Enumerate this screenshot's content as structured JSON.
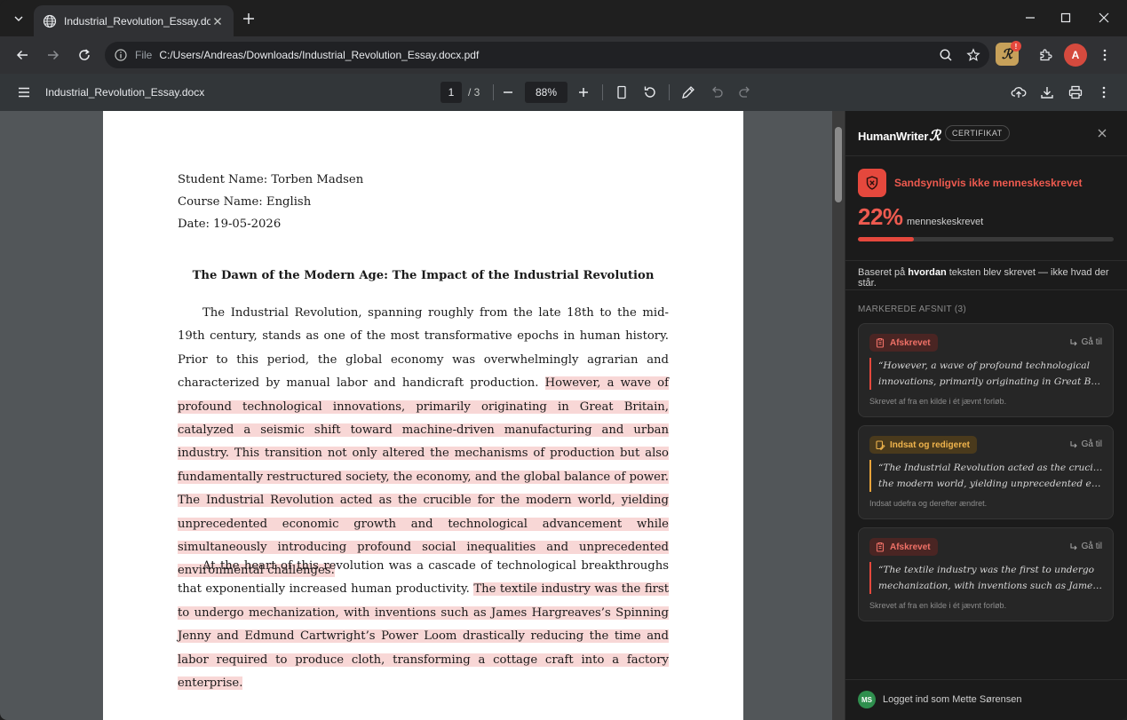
{
  "browser": {
    "tab_title": "Industrial_Revolution_Essay.docx...",
    "scheme_label": "File",
    "url": "C:/Users/Andreas/Downloads/Industrial_Revolution_Essay.docx.pdf",
    "extension_badge": "!",
    "profile_initial": "A"
  },
  "pdf_toolbar": {
    "doc_title": "Industrial_Revolution_Essay.docx",
    "page_current": "1",
    "page_total": "/ 3",
    "zoom": "88%"
  },
  "document": {
    "student": "Student Name: Torben Madsen",
    "course": "Course Name: English",
    "date": "Date: 19-05-2026",
    "title": "The Dawn of the Modern Age: The Impact of the Industrial Revolution",
    "p1_plain": "The Industrial Revolution, spanning roughly from the late 18th to the mid-19th century, stands as one of the most transformative epochs in human history. Prior to this period, the global economy was overwhelmingly agrarian and characterized by manual labor and handicraft production. ",
    "p1_hl1": "However, a wave of profound technological innovations, primarily originating in Great Britain, catalyzed a seismic shift toward machine-driven manufacturing and urban industry. This transition not only altered the mechanisms of production but also fundamentally restructured society, the economy, and the global balance of power.",
    "p1_hl2": "The Industrial Revolution acted as the crucible for the modern world, yielding unprecedented economic growth and technological advancement while simultaneously introducing profound social inequalities and unprecedented environmental challenges.",
    "p2_plain": "At the heart of this revolution was a cascade of technological breakthroughs that exponentially increased human productivity. ",
    "p2_hl": "The textile industry was the first to undergo mechanization, with inventions such as James Hargreaves’s Spinning Jenny and Edmund Cartwright’s Power Loom drastically reducing the time and labor required to produce cloth, transforming a cottage craft into a factory enterprise."
  },
  "sidebar": {
    "brand": "HumanWriter",
    "brand_mark": "ℛ",
    "cert_label": "CERTIFIKAT",
    "verdict": "Sandsynligvis ikke menneskeskrevet",
    "percent_text": "22%",
    "percent_value": 22,
    "percent_label": "menneskeskrevet",
    "basis_pre": "Baseret på ",
    "basis_bold": "hvordan",
    "basis_post": " teksten blev skrevet — ikke hvad der står.",
    "section_header": "MARKEREDE AFSNIT (3)",
    "goto_label": "Gå til",
    "cards": [
      {
        "tag": "Afskrevet",
        "line1": "“However, a wave of profound technological",
        "line2": "innovations, primarily originating in Great Britain,...",
        "note": "Skrevet af fra en kilde i ét jævnt forløb."
      },
      {
        "tag": "Indsat og redigeret",
        "line1": "“The Industrial Revolution acted as the crucible for",
        "line2": "the modern world, yielding unprecedented economi...",
        "note": "Indsat udefra og derefter ændret."
      },
      {
        "tag": "Afskrevet",
        "line1": "“The textile industry was the first to undergo",
        "line2": "mechanization, with inventions such as James...",
        "note": "Skrevet af fra en kilde i ét jævnt forløb."
      }
    ],
    "user_initials": "MS",
    "user_text": "Logget ind som Mette Sørensen"
  },
  "colors": {
    "highlight": "#f8d7d6",
    "danger": "#e5483d",
    "amber": "#e8a33a"
  }
}
